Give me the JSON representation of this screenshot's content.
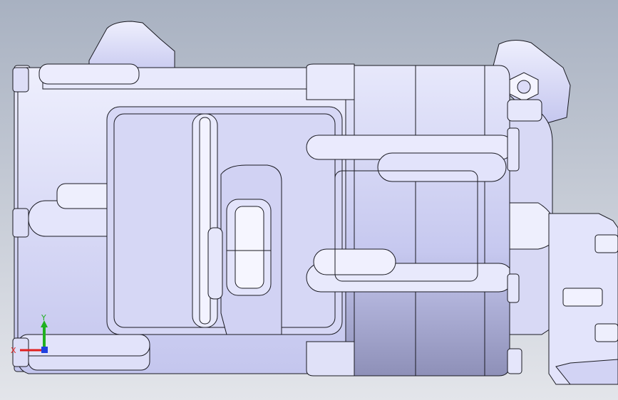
{
  "viewport": {
    "background_top": "#a8b1c1",
    "background_bottom": "#e3e5ea",
    "model_fill": "#dadbf7",
    "model_shade": "#b9bbe6",
    "model_edge": "#1a1a22"
  },
  "triad": {
    "x_label": "X",
    "y_label": "Y",
    "x_color": "#e02020",
    "y_color": "#20b020",
    "z_color": "#2040e0"
  }
}
